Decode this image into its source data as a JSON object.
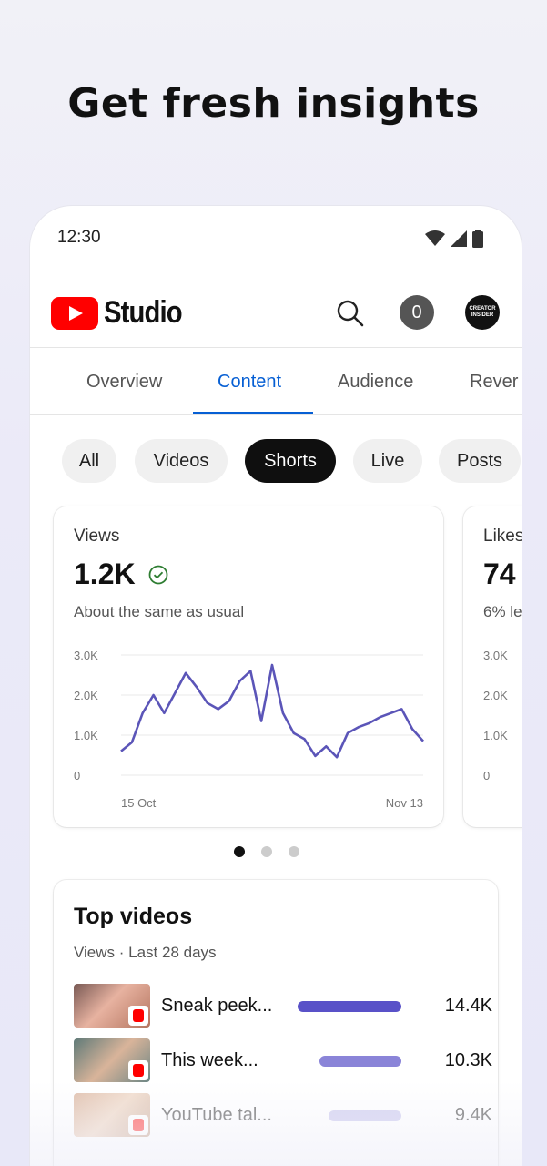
{
  "headline": "Get fresh insights",
  "status_bar": {
    "time": "12:30",
    "icons": [
      "wifi-icon",
      "signal-icon",
      "battery-icon"
    ]
  },
  "app_bar": {
    "logo_text": "Studio",
    "notification_count": "0",
    "avatar_text": "CREATOR INSIDER"
  },
  "tabs": [
    {
      "label": "Overview",
      "active": false
    },
    {
      "label": "Content",
      "active": true
    },
    {
      "label": "Audience",
      "active": false
    },
    {
      "label": "Rever",
      "active": false
    }
  ],
  "chips": [
    {
      "label": "All",
      "active": false
    },
    {
      "label": "Videos",
      "active": false
    },
    {
      "label": "Shorts",
      "active": true
    },
    {
      "label": "Live",
      "active": false
    },
    {
      "label": "Posts",
      "active": false
    }
  ],
  "views_card": {
    "label": "Views",
    "value": "1.2K",
    "sub": "About the same as usual"
  },
  "likes_card": {
    "label": "Likes",
    "value": "74",
    "sub": "6% le"
  },
  "chart_data": [
    {
      "type": "line",
      "title": "",
      "xlabel": "",
      "ylabel": "",
      "y_ticks": [
        "3.0K",
        "2.0K",
        "1.0K",
        "0"
      ],
      "x_tick_labels": [
        "15 Oct",
        "Nov 13"
      ],
      "ylim": [
        0,
        3000
      ],
      "x": [
        1,
        2,
        3,
        4,
        5,
        6,
        7,
        8,
        9,
        10,
        11,
        12,
        13,
        14,
        15,
        16,
        17,
        18,
        19,
        20,
        21,
        22,
        23,
        24,
        25,
        26,
        27,
        28,
        29
      ],
      "values": [
        600,
        820,
        1550,
        2000,
        1550,
        2050,
        2550,
        2200,
        1800,
        1650,
        1850,
        2350,
        2600,
        1350,
        2750,
        1550,
        1050,
        900,
        480,
        720,
        450,
        1050,
        1200,
        1300,
        1450,
        1550,
        1650,
        1150,
        850
      ],
      "series_color": "#5b55b8",
      "grid": true
    },
    {
      "type": "line",
      "title": "",
      "y_ticks": [
        "3.0K",
        "2.0K",
        "1.0K",
        "0"
      ],
      "ylim": [
        0,
        3000
      ],
      "partially_visible": true
    }
  ],
  "pagination": {
    "count": 3,
    "active_index": 0
  },
  "top_videos": {
    "title": "Top videos",
    "subtitle": "Views · Last 28 days",
    "rows": [
      {
        "title": "Sneak peek...",
        "value": "14.4K",
        "views": 14400,
        "bar_color": "#5951c8"
      },
      {
        "title": "This week...",
        "value": "10.3K",
        "views": 10300,
        "bar_color": "#8a84d8"
      },
      {
        "title": "YouTube tal...",
        "value": "9.4K",
        "views": 9400,
        "bar_color": "#b9b5e8"
      }
    ]
  },
  "colors": {
    "accent": "#065fd4",
    "brand_red": "#ff0000",
    "chart_line": "#5b55b8"
  }
}
